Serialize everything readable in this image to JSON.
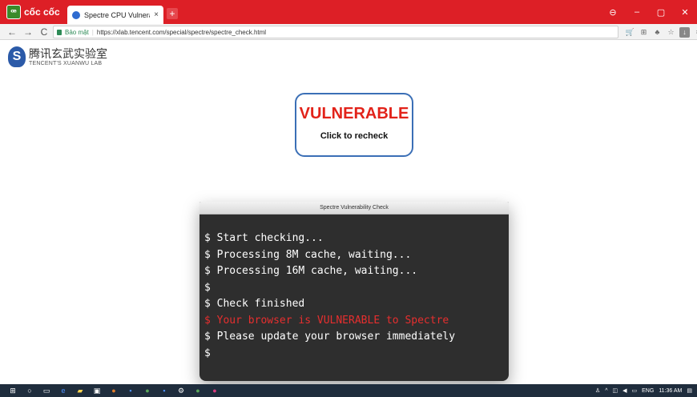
{
  "browser": {
    "brand": "cốc cốc",
    "tab_title": "Spectre CPU Vulnerability",
    "tab_close": "×",
    "new_tab": "+",
    "window_controls": [
      "⊖",
      "–",
      "▢",
      "✕"
    ],
    "nav": {
      "back": "←",
      "forward": "→",
      "reload": "C"
    },
    "security_label": "Bảo mật",
    "url": "https://xlab.tencent.com/special/spectre/spectre_check.html",
    "accent_color": "#dd1f26"
  },
  "page": {
    "lab_name_cn": "腾讯玄武实验室",
    "lab_name_en": "TENCENT'S XUANWU LAB",
    "result": {
      "status": "VULNERABLE",
      "action": "Click to recheck",
      "status_color": "#e2231a"
    },
    "terminal": {
      "title": "Spectre Vulnerability Check",
      "lines": [
        "$ Start checking...",
        "$ Processing 8M cache, waiting...",
        "$ Processing 16M cache, waiting...",
        "$",
        "$ Check finished",
        "$ Your browser is VULNERABLE to Spectre",
        "$ Please update your browser immediately",
        "$"
      ]
    }
  },
  "taskbar": {
    "language": "ENG",
    "time": "11:36 AM"
  }
}
